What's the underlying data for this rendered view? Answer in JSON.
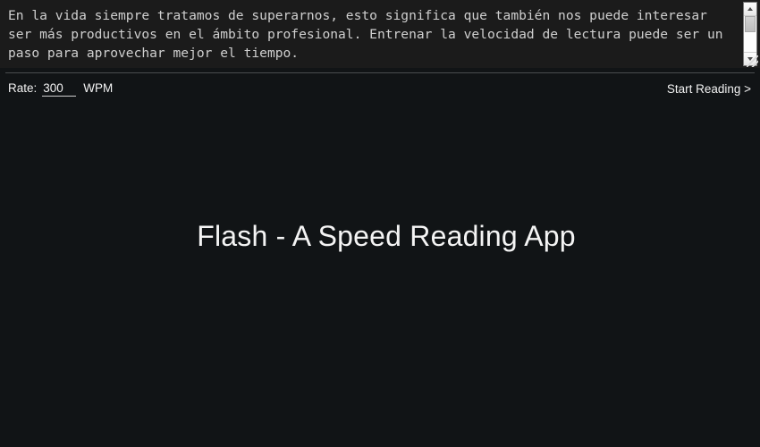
{
  "editor": {
    "text": "En la vida siempre tratamos de superarnos, esto significa que también nos puede interesar ser más productivos en el ámbito profesional. Entrenar la velocidad de lectura puede ser un paso para aprovechar mejor el tiempo.",
    "placeholder": "",
    "scrollbar": {
      "up_arrow": "scroll-up-arrow",
      "down_arrow": "scroll-down-arrow"
    }
  },
  "controls": {
    "rate_label": "Rate:",
    "rate_value": "300",
    "rate_placeholder": "300",
    "unit_label": "WPM",
    "start_label": "Start Reading >"
  },
  "stage": {
    "title": "Flash - A Speed Reading App"
  },
  "colors": {
    "page_background": "#111416",
    "editor_background": "#1b1b1b",
    "editor_text": "#cfcfcf",
    "primary_text": "#f2f2f2",
    "divider": "#4a4d4f",
    "scrollbar_face": "#fdfdfd"
  }
}
